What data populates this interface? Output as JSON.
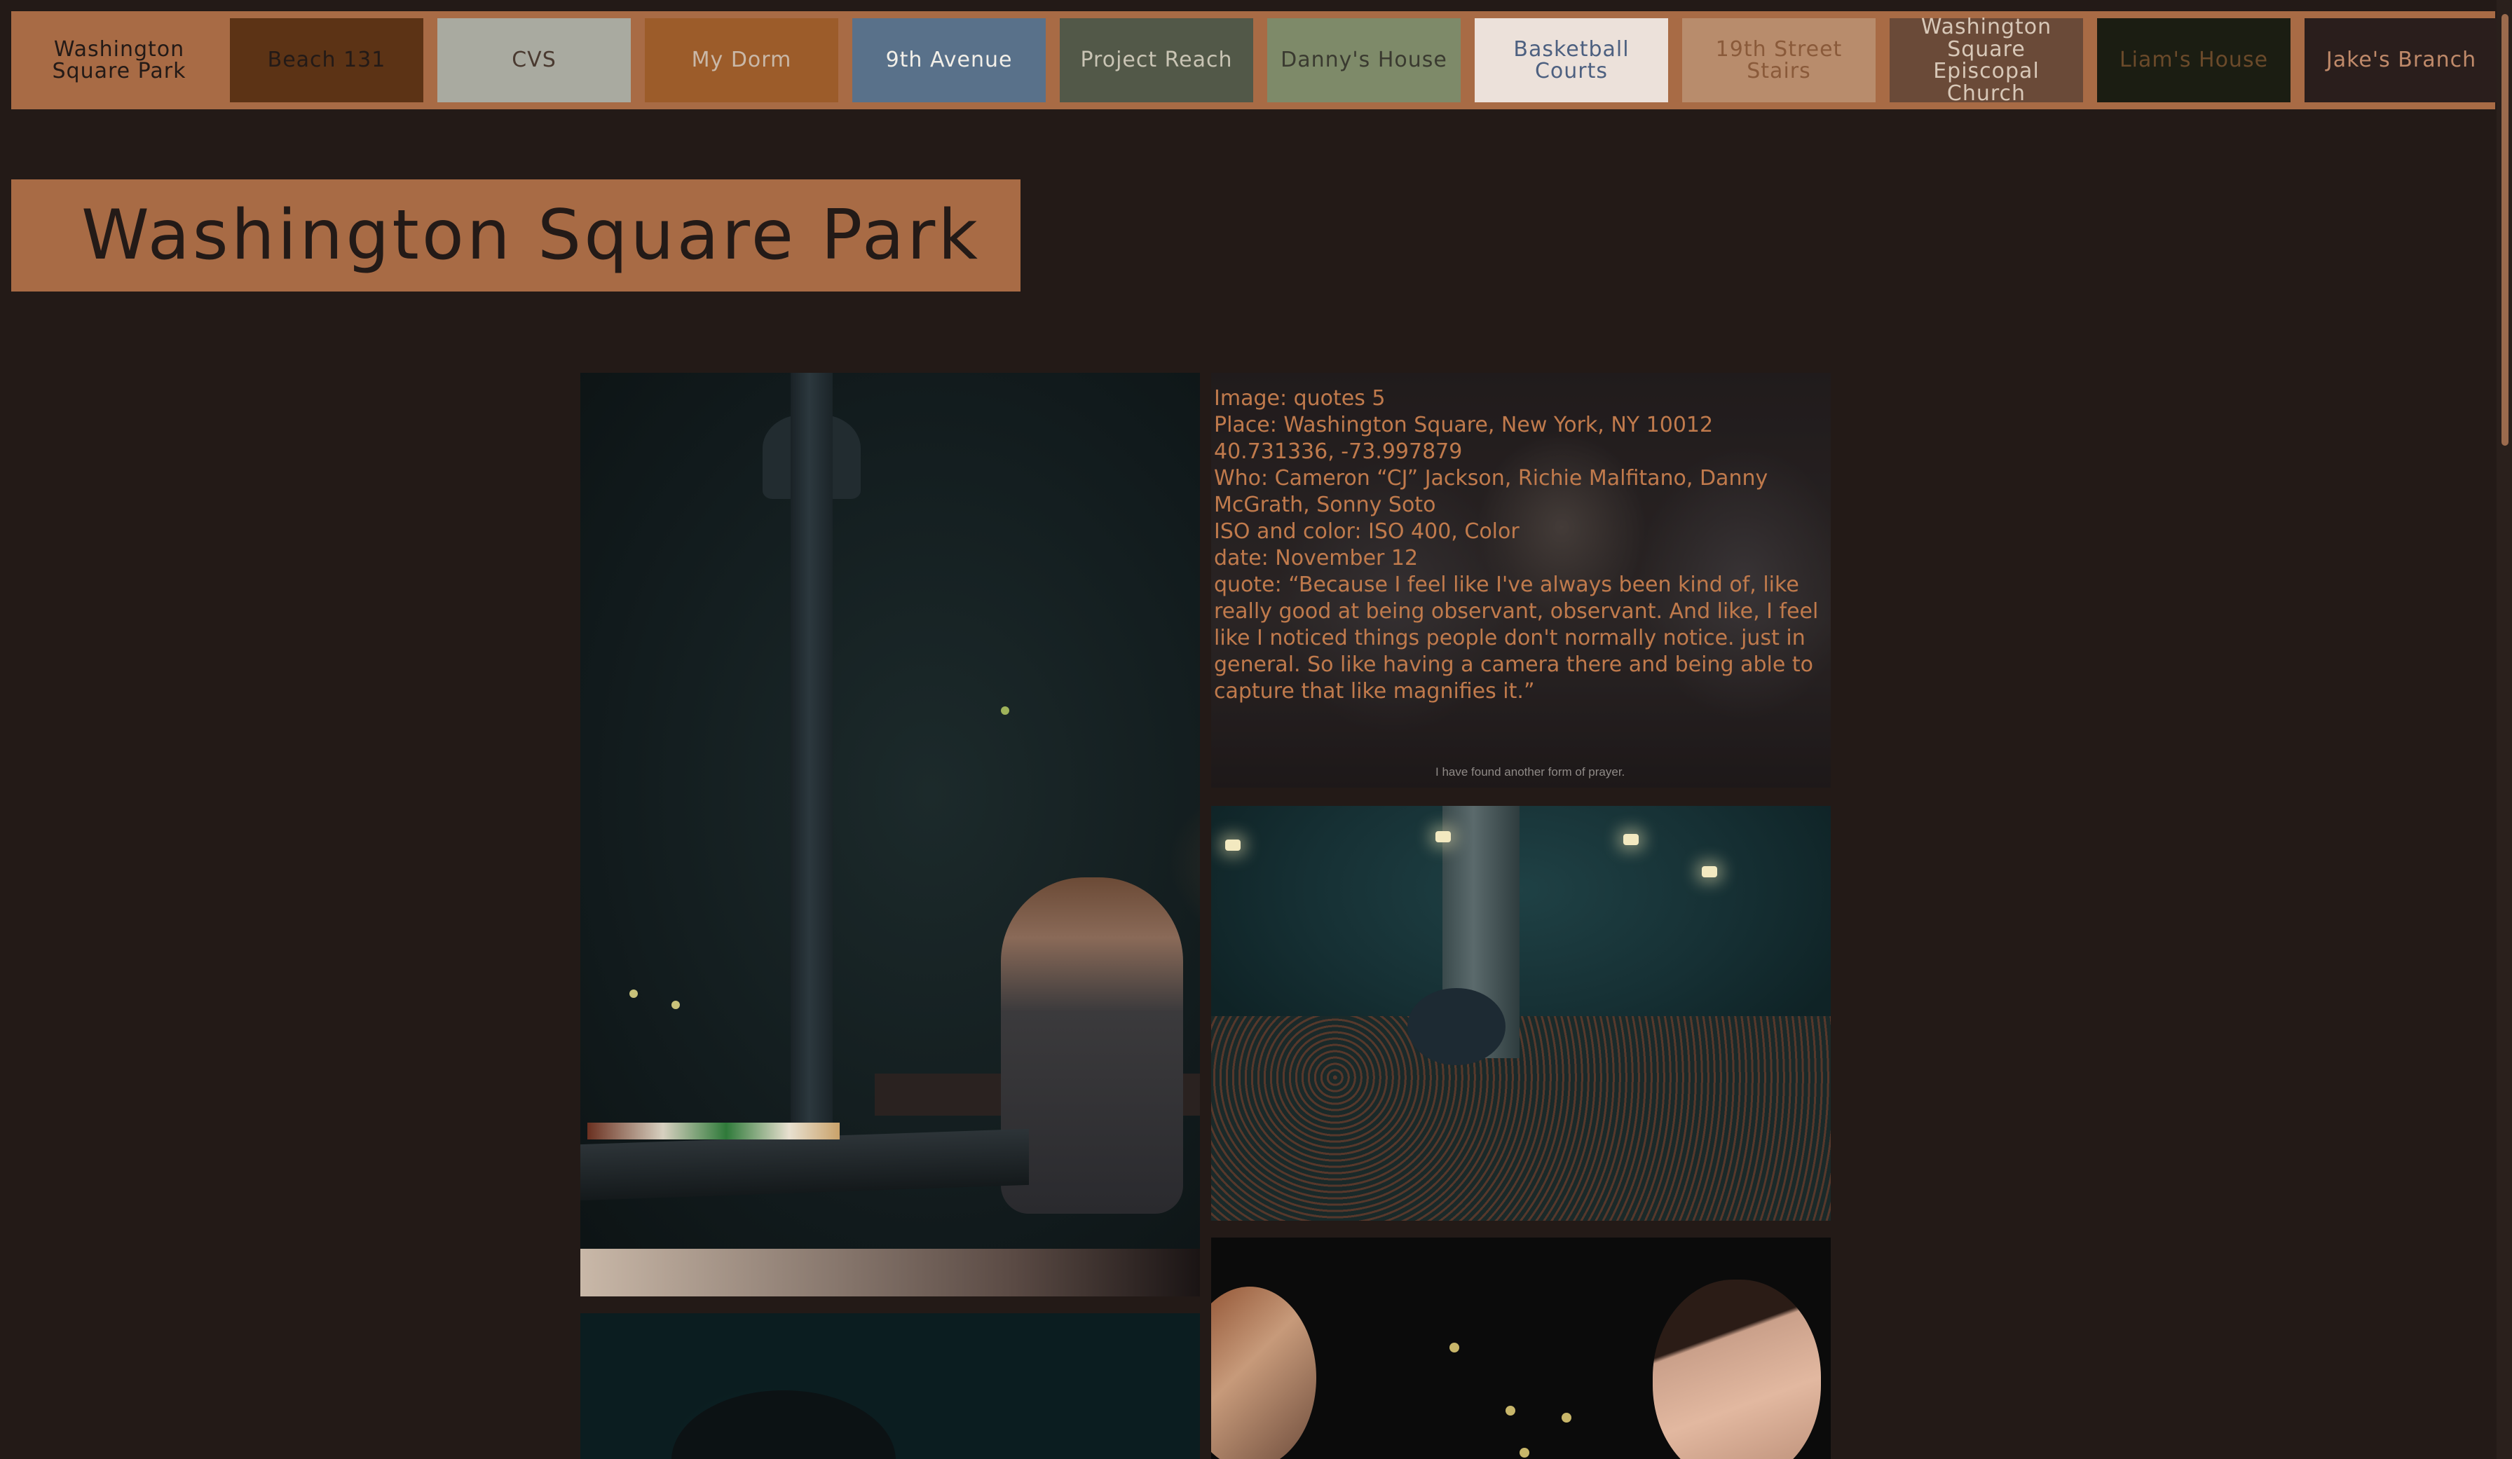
{
  "nav": {
    "tabs": [
      {
        "label": "Washington Square Park",
        "bg": "#a86b45",
        "fg": "#231a17"
      },
      {
        "label": "Beach 131",
        "bg": "#5c3315",
        "fg": "#231a17"
      },
      {
        "label": "CVS",
        "bg": "#a9aaa0",
        "fg": "#4a3a30"
      },
      {
        "label": "My Dorm",
        "bg": "#9c5c2a",
        "fg": "#c9b8a8"
      },
      {
        "label": "9th Avenue",
        "bg": "#59718a",
        "fg": "#f2efe8"
      },
      {
        "label": "Project Reach",
        "bg": "#525848",
        "fg": "#c9c4b4"
      },
      {
        "label": "Danny's House",
        "bg": "#7e8a69",
        "fg": "#3a3a30"
      },
      {
        "label": "Basketball Courts",
        "bg": "#ece1da",
        "fg": "#4d6080"
      },
      {
        "label": "19th Street Stairs",
        "bg": "#b88c6c",
        "fg": "#8a5a3a"
      },
      {
        "label": "Washington Square Episcopal Church",
        "bg": "#6a4a38",
        "fg": "#d8c8b8"
      },
      {
        "label": "Liam's House",
        "bg": "#1b1d12",
        "fg": "#6b4a2a"
      },
      {
        "label": "Jake's Branch",
        "bg": "#2a1e1c",
        "fg": "#c08a6a"
      }
    ]
  },
  "page": {
    "title": "Washington Square Park"
  },
  "quote_card": {
    "image": "Image: quotes 5",
    "place": "Place: Washington Square, New York, NY 10012",
    "coords": "40.731336, -73.997879",
    "who": "Who: Cameron “CJ” Jackson, Richie Malfitano, Danny McGrath, Sonny Soto",
    "iso": "ISO and color: ISO 400, Color",
    "date": "date: November 12",
    "quote": "quote: “Because I feel like I've always been kind of, like really good at being observant, observant. And like, I feel like I noticed things people don't normally notice. just in general. So like having a camera there and being able to capture that like magnifies it.”",
    "caption": "I have found another form of prayer."
  },
  "colors": {
    "background": "#231a17",
    "accent": "#a86b45",
    "quote_text": "#c07a4c"
  }
}
